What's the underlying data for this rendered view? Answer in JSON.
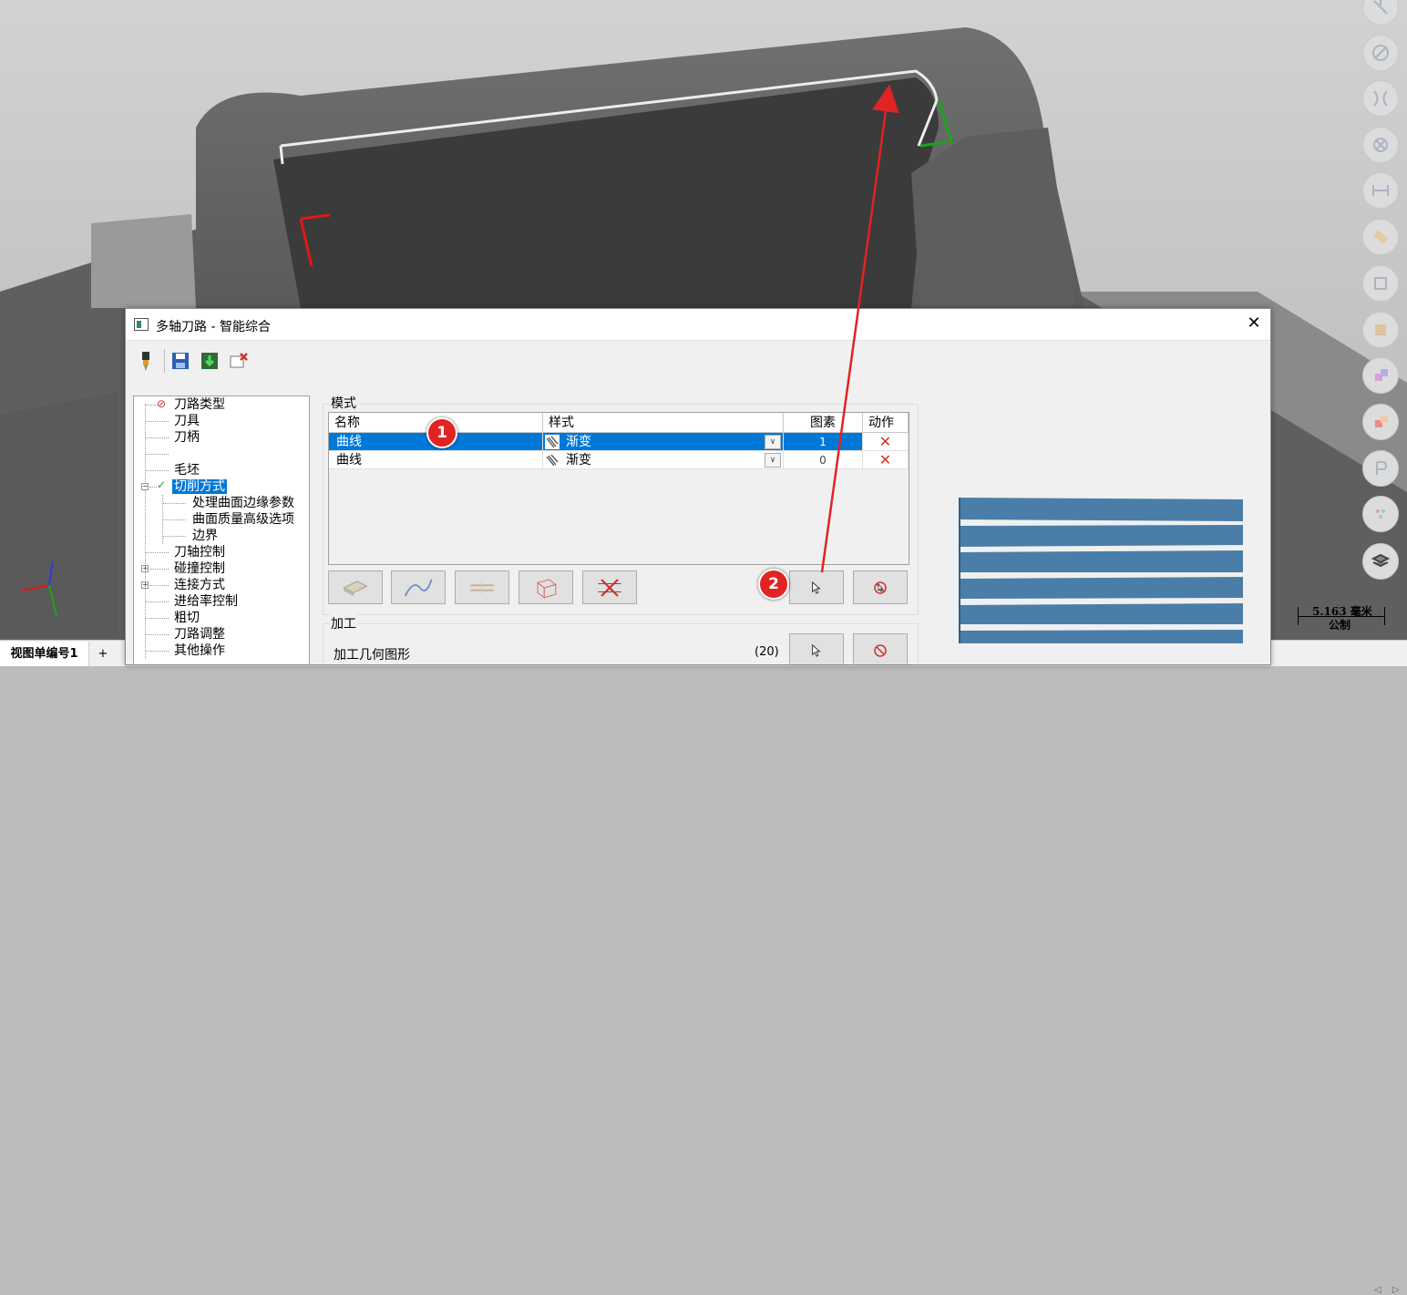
{
  "window": {
    "title": "多轴刀路 - 智能综合",
    "close_glyph": "✕"
  },
  "toolbar": {
    "icons": [
      "tool-icon",
      "save-icon",
      "save-apply-icon",
      "delete-icon"
    ]
  },
  "tree": {
    "items": [
      {
        "label": "刀路类型",
        "status": "error"
      },
      {
        "label": "刀具"
      },
      {
        "label": "刀柄"
      },
      {
        "label": ""
      },
      {
        "label": "毛坯"
      },
      {
        "label": "切削方式",
        "status": "ok",
        "selected": true
      },
      {
        "label": "处理曲面边缘参数"
      },
      {
        "label": "曲面质量高级选项"
      },
      {
        "label": "边界"
      },
      {
        "label": "刀轴控制"
      },
      {
        "label": "碰撞控制"
      },
      {
        "label": "连接方式"
      },
      {
        "label": "进给率控制"
      },
      {
        "label": "粗切"
      },
      {
        "label": "刀路调整"
      },
      {
        "label": "其他操作"
      }
    ]
  },
  "mode": {
    "group_label": "模式",
    "columns": [
      "名称",
      "样式",
      "图素",
      "动作"
    ],
    "rows": [
      {
        "name": "曲线",
        "style": "渐变",
        "count": "1",
        "selected": true
      },
      {
        "name": "曲线",
        "style": "渐变",
        "count": "0",
        "selected": false
      }
    ]
  },
  "process": {
    "group_label": "加工",
    "geometry_label": "加工几何图形",
    "geometry_count": "(20)"
  },
  "annotations": {
    "badge1": "1",
    "badge2": "2"
  },
  "statusbar": {
    "tab_label": "视图单编号1",
    "add_tab": "+",
    "nav_prev": "◁",
    "nav_next": "▷"
  },
  "scale": {
    "value": "5.163 毫米",
    "unit": "公制"
  },
  "colors": {
    "accent": "#0078d7",
    "annotation_red": "#e22323",
    "preview_blue": "#4a7ea8"
  }
}
